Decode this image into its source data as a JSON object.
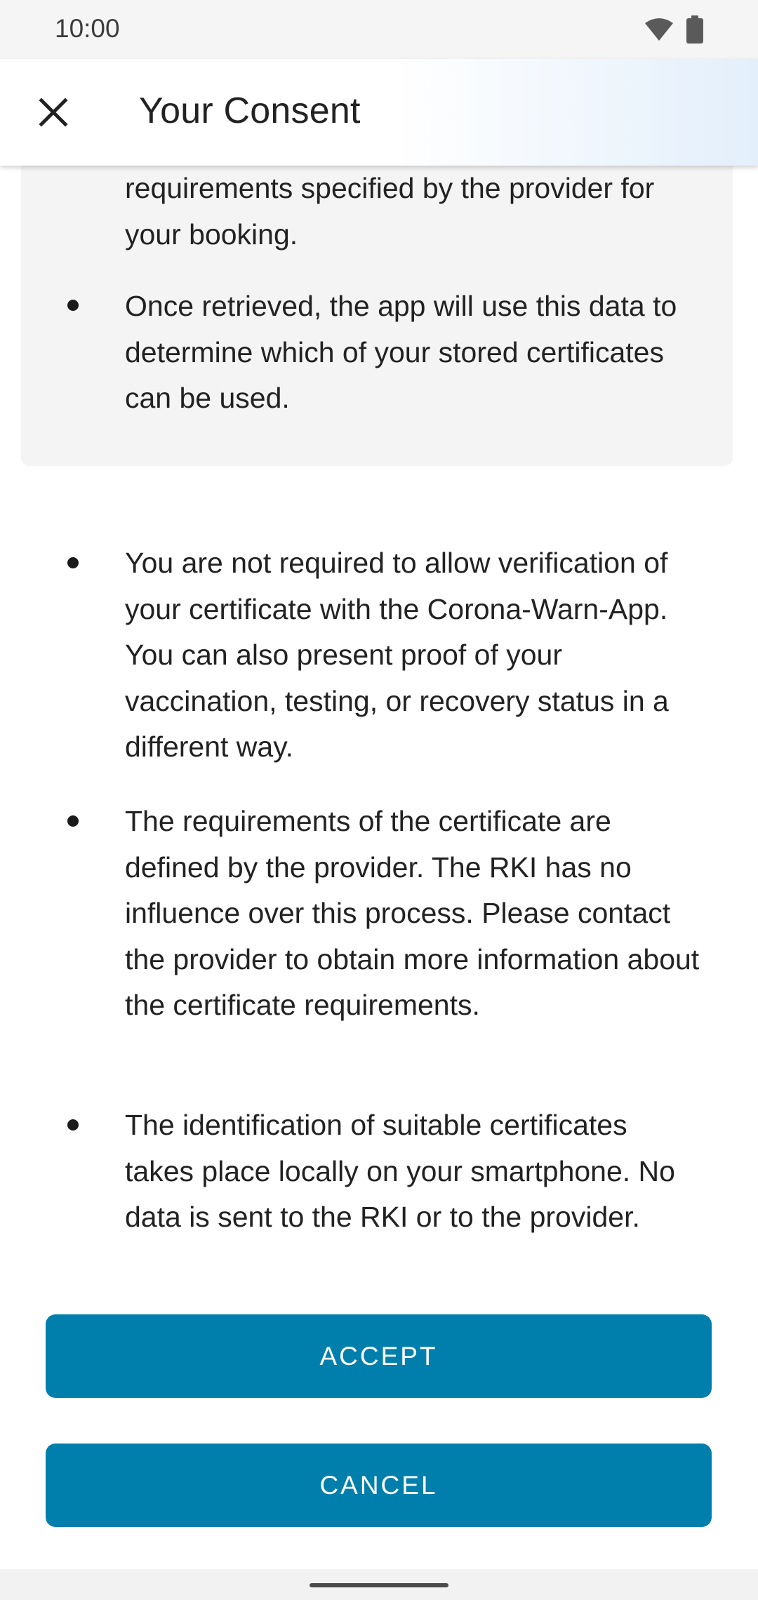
{
  "status_bar": {
    "time": "10:00",
    "icons": [
      "wifi-icon",
      "battery-icon"
    ]
  },
  "app_bar": {
    "title": "Your Consent",
    "close_icon": "close-icon"
  },
  "info_box": {
    "partial_text": "requirements specified by the provider for your booking.",
    "bullets": [
      "Once retrieved, the app will use this data to determine which of your stored certificates can be used."
    ]
  },
  "bullets": [
    "You are not required to allow verification of your certificate with the Corona-Warn-App. You can also present proof of your vaccination, testing, or recovery status in a different way.",
    "The requirements of the certificate are defined by the provider. The RKI has no influence over this process. Please contact the provider to obtain more information about the certificate requirements.",
    "The identification of suitable certificates takes place locally on your smartphone. No data is sent to the RKI or to the provider."
  ],
  "buttons": {
    "accept": "ACCEPT",
    "cancel": "CANCEL"
  },
  "colors": {
    "primary_button": "#007fad",
    "info_box_bg": "#f4f4f4",
    "status_bar_bg": "#f5f5f5"
  }
}
